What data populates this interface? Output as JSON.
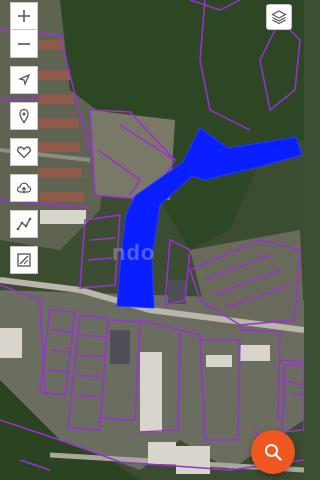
{
  "map": {
    "watermark_text": "ndo",
    "colors": {
      "parcel_outline": "#9b30d9",
      "highlighted_parcel": "#0a1fff",
      "vegetation": "#2f4a26",
      "fab": "#f0561f"
    }
  },
  "toolbar": {
    "zoom_in_icon": "plus-icon",
    "zoom_out_icon": "minus-icon",
    "locate_icon": "navigation-arrow-icon",
    "marker_icon": "map-pin-icon",
    "favorite_icon": "heart-icon",
    "upload_icon": "cloud-upload-icon",
    "measure_line_icon": "polyline-icon",
    "measure_area_icon": "area-icon"
  },
  "layers_icon": "layers-icon",
  "search_icon": "search-icon"
}
